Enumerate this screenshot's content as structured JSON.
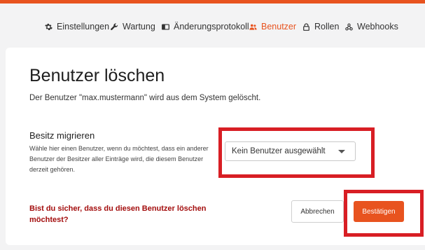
{
  "nav": {
    "items": [
      {
        "label": "Einstellungen",
        "icon": "gear-icon",
        "active": false
      },
      {
        "label": "Wartung",
        "icon": "wrench-icon",
        "active": false
      },
      {
        "label": "Änderungsprotokoll",
        "icon": "book-icon",
        "active": false
      },
      {
        "label": "Benutzer",
        "icon": "users-icon",
        "active": true
      },
      {
        "label": "Rollen",
        "icon": "lock-icon",
        "active": false
      },
      {
        "label": "Webhooks",
        "icon": "webhook-icon",
        "active": false
      }
    ]
  },
  "dialog": {
    "title": "Benutzer löschen",
    "subtitle": "Der Benutzer \"max.mustermann\" wird aus dem System gelöscht.",
    "migrate": {
      "title": "Besitz migrieren",
      "description": "Wähle hier einen Benutzer, wenn du möchtest, dass ein anderer Benutzer der Besitzer aller Einträge wird, die diesem Benutzer derzeit gehören.",
      "select_value": "Kein Benutzer ausgewählt"
    },
    "question": "Bist du sicher, dass du diesen Benutzer löschen möchtest?",
    "cancel_label": "Abbrechen",
    "confirm_label": "Bestätigen"
  },
  "colors": {
    "accent": "#e8531f",
    "highlight": "#d81e24",
    "warning_text": "#a30d0d"
  }
}
